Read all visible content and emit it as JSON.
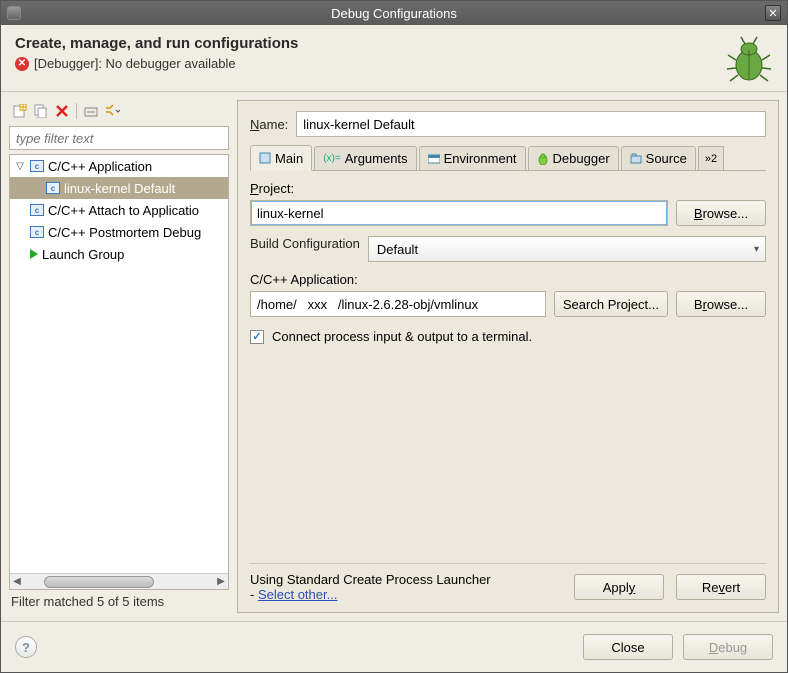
{
  "window": {
    "title": "Debug Configurations"
  },
  "header": {
    "title": "Create, manage, and run configurations",
    "error": "[Debugger]: No debugger available"
  },
  "left": {
    "filter_placeholder": "type filter text",
    "items": [
      "C/C++ Application",
      "linux-kernel Default",
      "C/C++ Attach to Applicatio",
      "C/C++ Postmortem Debug",
      "Launch Group"
    ],
    "status": "Filter matched 5 of 5 items"
  },
  "form": {
    "name_label": "Name:",
    "name_value": "linux-kernel Default",
    "tabs": [
      "Main",
      "Arguments",
      "Environment",
      "Debugger",
      "Source"
    ],
    "tabs_more": "»2",
    "project_label": "Project:",
    "project_value": "linux-kernel",
    "browse": "Browse...",
    "build_label": "Build Configuration",
    "build_value": "Default",
    "app_label": "C/C++ Application:",
    "app_value": "/home/   xxx   /linux-2.6.28-obj/vmlinux",
    "search_project": "Search Project...",
    "connect": "Connect process input & output to a terminal.",
    "launcher_line1": "Using Standard Create Process Launcher",
    "launcher_line2_prefix": "- ",
    "launcher_link": "Select other...",
    "apply": "Apply",
    "revert": "Revert"
  },
  "footer": {
    "close": "Close",
    "debug": "Debug"
  }
}
